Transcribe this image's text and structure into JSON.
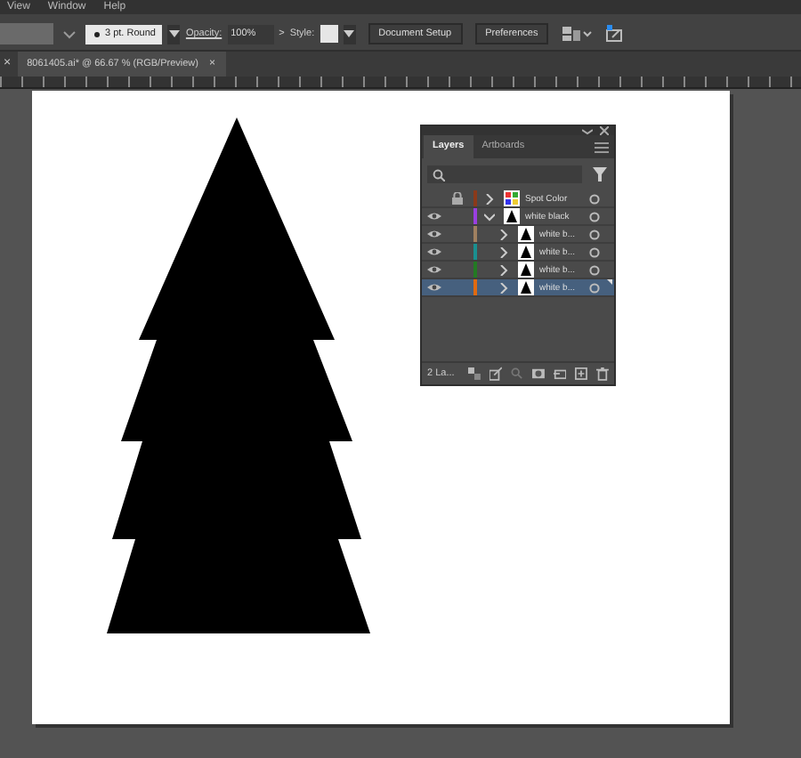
{
  "menu_bar": {
    "items": [
      "View",
      "Window",
      "Help"
    ]
  },
  "control_bar": {
    "stroke_profile": "3 pt. Round",
    "opacity_label": "Opacity:",
    "opacity": "100%",
    "opacity_arrow": ">",
    "style_label": "Style:",
    "buttons": [
      "Document Setup",
      "Preferences"
    ]
  },
  "document_tab": {
    "close_left": "×",
    "title": "8061405.ai* @ 66.67 % (RGB/Preview)",
    "close": "×"
  },
  "layers_panel": {
    "tabs": [
      {
        "label": "Layers",
        "selected": true
      },
      {
        "label": "Artboards",
        "selected": false
      }
    ],
    "rows": [
      {
        "name": "Spot Color",
        "visible": false,
        "locked": true,
        "color": "#8b3a1a",
        "expanded": false,
        "selected": false,
        "kind": "swatch",
        "children": []
      },
      {
        "name": "white black",
        "visible": true,
        "locked": false,
        "color": "#9a3fe0",
        "expanded": true,
        "selected": false,
        "kind": "artwork",
        "children": [
          {
            "name": "white b...",
            "visible": true,
            "locked": false,
            "color": "#a08060",
            "expanded": false,
            "selected": false,
            "kind": "artwork"
          },
          {
            "name": "white b...",
            "visible": true,
            "locked": false,
            "color": "#1a9090",
            "expanded": false,
            "selected": false,
            "kind": "artwork"
          },
          {
            "name": "white b...",
            "visible": true,
            "locked": false,
            "color": "#237a23",
            "expanded": false,
            "selected": false,
            "kind": "artwork"
          },
          {
            "name": "white b...",
            "visible": true,
            "locked": false,
            "color": "#e06a10",
            "expanded": false,
            "selected": true,
            "kind": "artwork"
          }
        ]
      }
    ],
    "footer": "2 La..."
  }
}
